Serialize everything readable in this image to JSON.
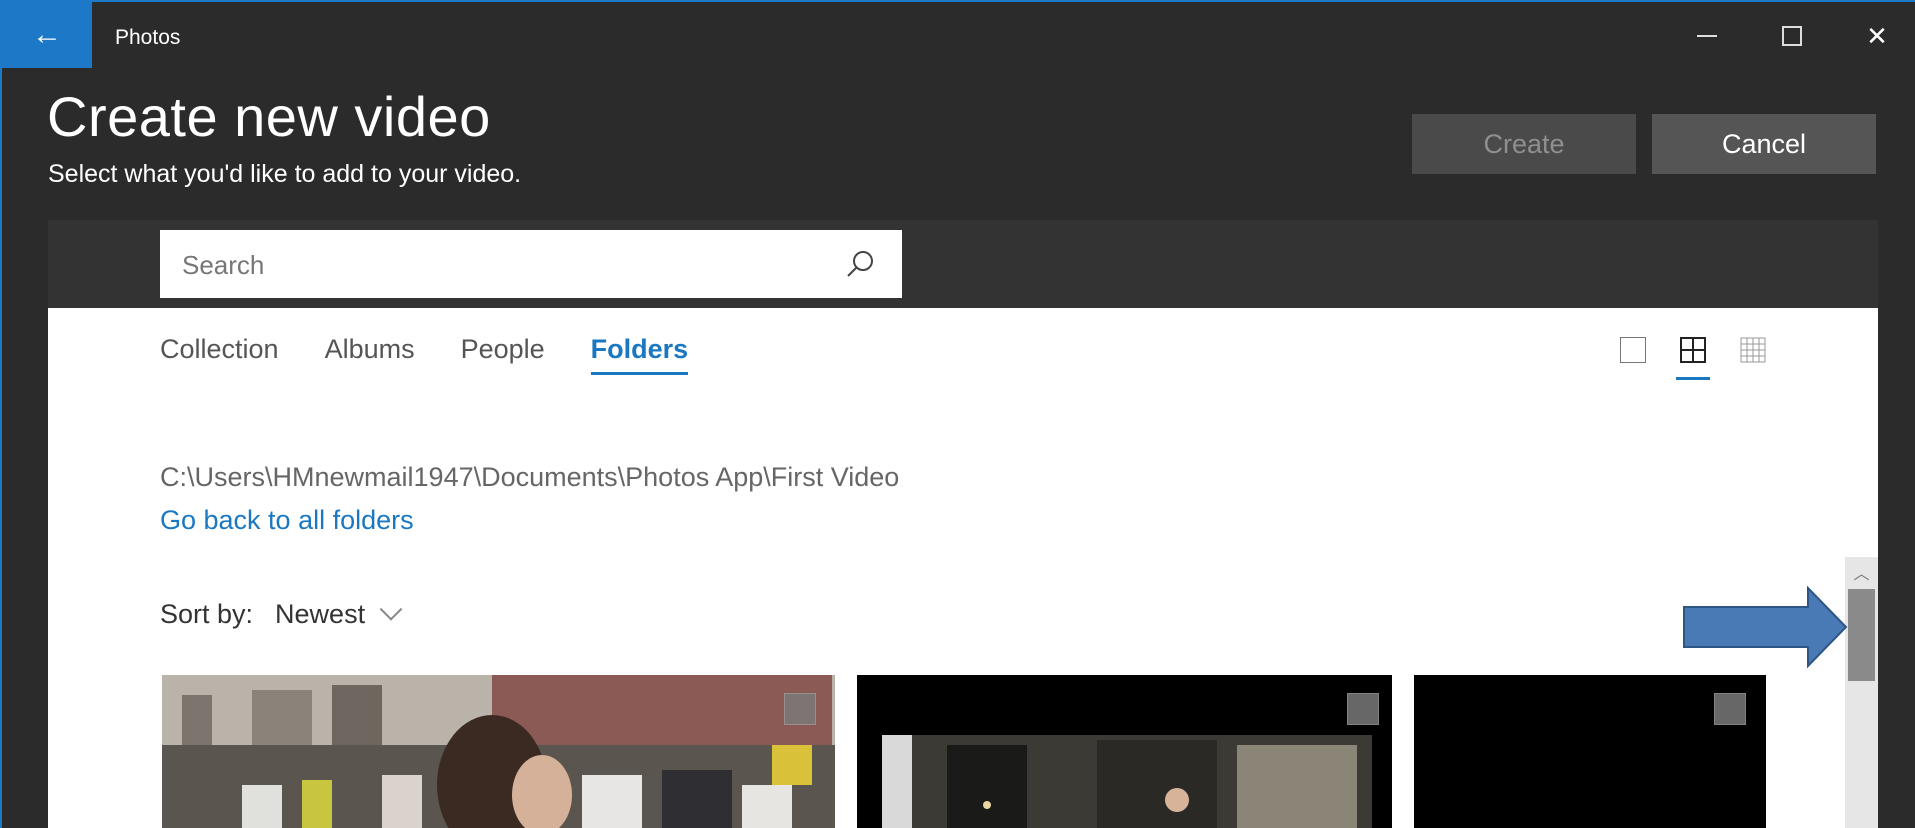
{
  "window": {
    "app_title": "Photos",
    "back_glyph": "←",
    "close_glyph": "✕"
  },
  "header": {
    "title": "Create new video",
    "subtitle": "Select what you'd like to add to your video.",
    "create_label": "Create",
    "cancel_label": "Cancel"
  },
  "search": {
    "placeholder": "Search"
  },
  "tabs": [
    {
      "label": "Collection",
      "active": false
    },
    {
      "label": "Albums",
      "active": false
    },
    {
      "label": "People",
      "active": false
    },
    {
      "label": "Folders",
      "active": true
    }
  ],
  "folder": {
    "path": "C:\\Users\\HMnewmail1947\\Documents\\Photos App\\First Video",
    "back_link": "Go back to all folders"
  },
  "sort": {
    "label": "Sort by:",
    "value": "Newest"
  },
  "scroll": {
    "up_glyph": "︿"
  },
  "colors": {
    "accent": "#1a78c2",
    "titlebar_accent": "#1e78c8",
    "annotation_arrow": "#4a7ab5"
  }
}
